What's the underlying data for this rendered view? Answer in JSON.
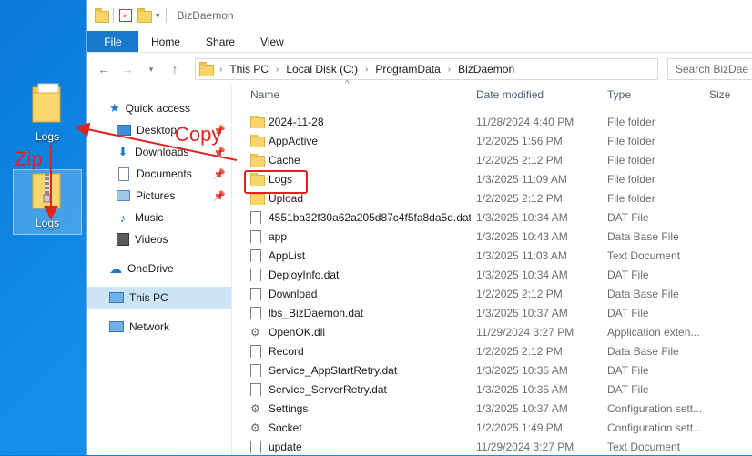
{
  "desktop": {
    "logs_folder_label": "Logs",
    "logs_zip_label": "Logs",
    "annot_copy": "Copy",
    "annot_zip": "Zip"
  },
  "window": {
    "title": "BizDaemon"
  },
  "ribbon": {
    "file": "File",
    "tabs": [
      "Home",
      "Share",
      "View"
    ]
  },
  "address": {
    "crumbs": [
      "This PC",
      "Local Disk (C:)",
      "ProgramData",
      "BizDaemon"
    ],
    "search_placeholder": "Search BizDae"
  },
  "nav": {
    "quick_access": "Quick access",
    "items": [
      {
        "label": "Desktop",
        "icon": "desktop-icon",
        "pinned": true
      },
      {
        "label": "Downloads",
        "icon": "downloads-icon",
        "pinned": true
      },
      {
        "label": "Documents",
        "icon": "documents-icon",
        "pinned": true
      },
      {
        "label": "Pictures",
        "icon": "pictures-icon",
        "pinned": true
      },
      {
        "label": "Music",
        "icon": "music-icon",
        "pinned": false
      },
      {
        "label": "Videos",
        "icon": "videos-icon",
        "pinned": false
      }
    ],
    "onedrive": "OneDrive",
    "thispc": "This PC",
    "network": "Network"
  },
  "columns": {
    "name": "Name",
    "date": "Date modified",
    "type": "Type",
    "size": "Size"
  },
  "files": [
    {
      "name": "2024-11-28",
      "date": "11/28/2024 4:40 PM",
      "type": "File folder",
      "icon": "folder"
    },
    {
      "name": "AppActive",
      "date": "1/2/2025 1:56 PM",
      "type": "File folder",
      "icon": "folder"
    },
    {
      "name": "Cache",
      "date": "1/2/2025 2:12 PM",
      "type": "File folder",
      "icon": "folder"
    },
    {
      "name": "Logs",
      "date": "1/3/2025 11:09 AM",
      "type": "File folder",
      "icon": "folder"
    },
    {
      "name": "Upload",
      "date": "1/2/2025 2:12 PM",
      "type": "File folder",
      "icon": "folder"
    },
    {
      "name": "4551ba32f30a62a205d87c4f5fa8da5d.dat",
      "date": "1/3/2025 10:34 AM",
      "type": "DAT File",
      "icon": "file"
    },
    {
      "name": "app",
      "date": "1/3/2025 10:43 AM",
      "type": "Data Base File",
      "icon": "file"
    },
    {
      "name": "AppList",
      "date": "1/3/2025 11:03 AM",
      "type": "Text Document",
      "icon": "file"
    },
    {
      "name": "DeployInfo.dat",
      "date": "1/3/2025 10:34 AM",
      "type": "DAT File",
      "icon": "file"
    },
    {
      "name": "Download",
      "date": "1/2/2025 2:12 PM",
      "type": "Data Base File",
      "icon": "file"
    },
    {
      "name": "lbs_BizDaemon.dat",
      "date": "1/3/2025 10:37 AM",
      "type": "DAT File",
      "icon": "file"
    },
    {
      "name": "OpenOK.dll",
      "date": "11/29/2024 3:27 PM",
      "type": "Application exten...",
      "icon": "gear"
    },
    {
      "name": "Record",
      "date": "1/2/2025 2:12 PM",
      "type": "Data Base File",
      "icon": "file"
    },
    {
      "name": "Service_AppStartRetry.dat",
      "date": "1/3/2025 10:35 AM",
      "type": "DAT File",
      "icon": "file"
    },
    {
      "name": "Service_ServerRetry.dat",
      "date": "1/3/2025 10:35 AM",
      "type": "DAT File",
      "icon": "file"
    },
    {
      "name": "Settings",
      "date": "1/3/2025 10:37 AM",
      "type": "Configuration sett...",
      "icon": "gear"
    },
    {
      "name": "Socket",
      "date": "1/2/2025 1:49 PM",
      "type": "Configuration sett...",
      "icon": "gear"
    },
    {
      "name": "update",
      "date": "11/29/2024 3:27 PM",
      "type": "Text Document",
      "icon": "file"
    }
  ],
  "colors": {
    "accent": "#1979ca",
    "annotation": "#e0231e",
    "desktop": "#0a79d9"
  }
}
